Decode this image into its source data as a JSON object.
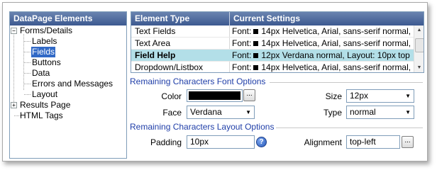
{
  "tree": {
    "header": "DataPage Elements",
    "expanders": {
      "collapse": "−",
      "expand": "+"
    },
    "items": [
      {
        "label": "Forms/Details"
      },
      {
        "label": "Labels"
      },
      {
        "label": "Fields"
      },
      {
        "label": "Buttons"
      },
      {
        "label": "Data"
      },
      {
        "label": "Errors and Messages"
      },
      {
        "label": "Layout"
      },
      {
        "label": "Results Page"
      },
      {
        "label": "HTML Tags"
      }
    ],
    "selected": "Fields"
  },
  "grid": {
    "columns": [
      "Element Type",
      "Current Settings"
    ],
    "rows": [
      {
        "type": "Text Fields",
        "setting_prefix": "Font:",
        "setting": "14px Helvetica, Arial, sans-serif normal,",
        "selected": false
      },
      {
        "type": "Text Area",
        "setting_prefix": "Font:",
        "setting": "14px Helvetica, Arial, sans-serif normal,",
        "selected": false
      },
      {
        "type": "Field Help",
        "setting_prefix": "Font:",
        "setting": "12px Verdana normal, Layout: 10px top",
        "selected": true
      },
      {
        "type": "Dropdown/Listbox",
        "setting_prefix": "Font:",
        "setting": "14px Helvetica, Arial, sans-serif normal,",
        "selected": false
      }
    ],
    "scroll_up": "▲",
    "scroll_down": "▼"
  },
  "font_options": {
    "title": "Remaining Characters Font Options",
    "color_label": "Color",
    "color_value": "#000000",
    "browse_label": "...",
    "size_label": "Size",
    "size_value": "12px",
    "face_label": "Face",
    "face_value": "Verdana",
    "type_label": "Type",
    "type_value": "normal"
  },
  "layout_options": {
    "title": "Remaining Characters Layout Options",
    "padding_label": "Padding",
    "padding_value": "10px",
    "help_icon": "?",
    "alignment_label": "Alignment",
    "alignment_value": "top-left",
    "browse_label": "..."
  },
  "colors": {
    "header_bg": "#3c5990",
    "selected_row": "#b3dfe8",
    "tree_selected": "#3169c6",
    "section_title": "#1f3ea8"
  }
}
